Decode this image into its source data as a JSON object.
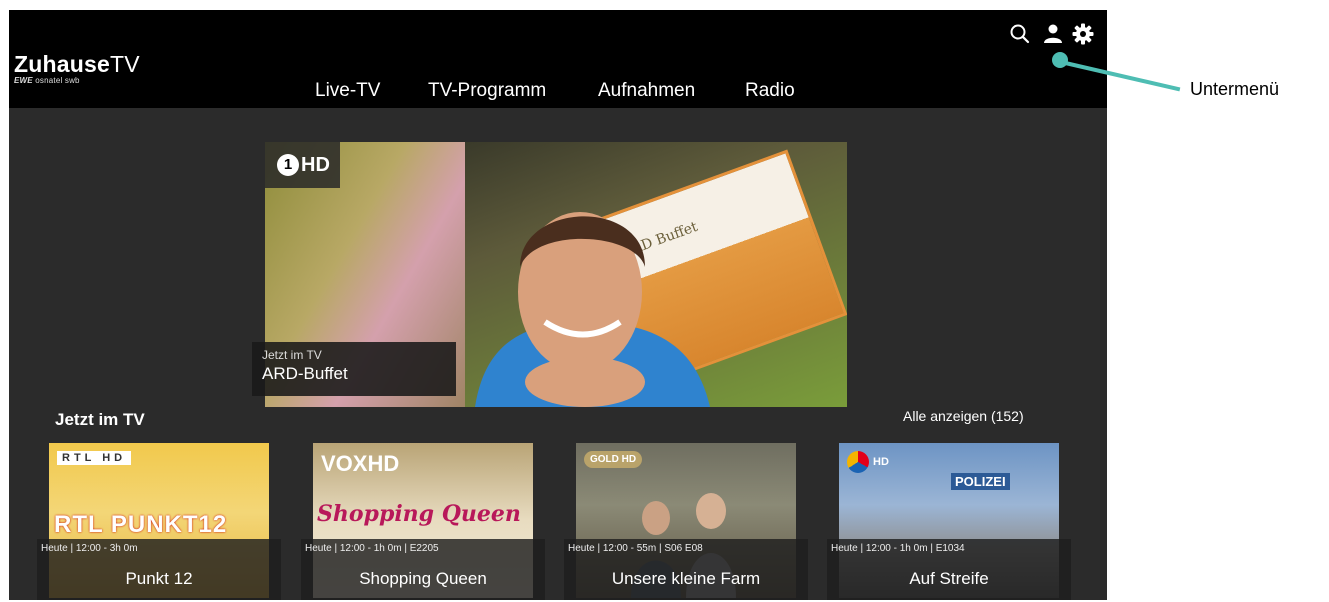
{
  "app": {
    "logo_main": "Zuhause",
    "logo_tv": "TV",
    "logo_partners_brand": "EWE",
    "logo_partners_rest": " osnatel swb"
  },
  "nav": {
    "items": [
      {
        "label": "Live-TV"
      },
      {
        "label": "TV-Programm"
      },
      {
        "label": "Aufnahmen"
      },
      {
        "label": "Radio"
      }
    ]
  },
  "top_icons": [
    "search-icon",
    "profile-icon",
    "settings-icon"
  ],
  "hero": {
    "channel": "HD",
    "channel_number": "1",
    "label": "Jetzt im TV",
    "title": "ARD-Buffet",
    "sign_text": "ARD Buffet"
  },
  "section": {
    "title": "Jetzt im TV",
    "show_all": "Alle anzeigen (152)"
  },
  "cards": [
    {
      "channel": "RTL HD",
      "meta": "Heute | 12:00 - 3h 0m",
      "title": "Punkt 12",
      "art_text": "RTL PUNKT12"
    },
    {
      "channel": "VOXHD",
      "meta": "Heute | 12:00 - 1h 0m | E2205",
      "title": "Shopping Queen",
      "art_text": "Shopping Queen"
    },
    {
      "channel": "GOLD HD",
      "meta": "Heute | 12:00 - 55m | S06 E08",
      "title": "Unsere kleine Farm",
      "art_text": ""
    },
    {
      "channel": "HD",
      "meta": "Heute | 12:00 - 1h 0m | E1034",
      "title": "Auf Streife",
      "art_text": "POLIZEI"
    }
  ],
  "annotation": {
    "label": "Untermenü",
    "color": "#4ebdb3"
  },
  "colors": {
    "background": "#2b2b2b",
    "topbar": "#000000",
    "text": "#ffffff"
  }
}
